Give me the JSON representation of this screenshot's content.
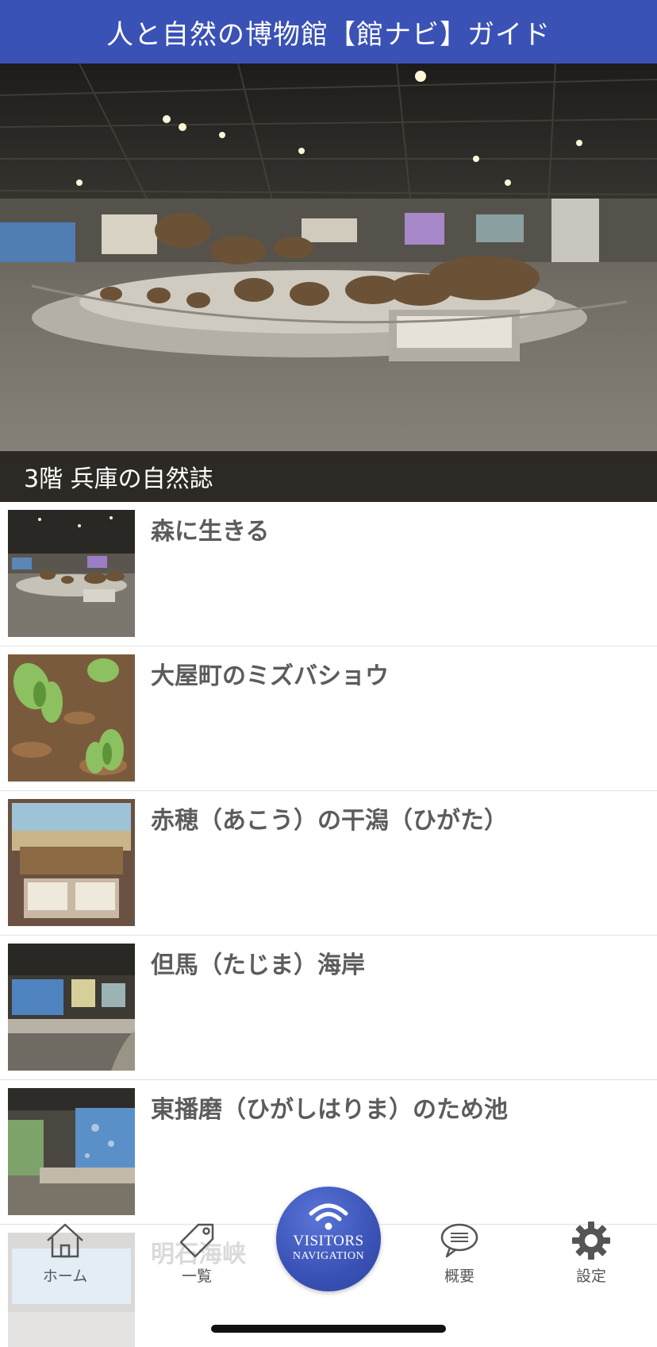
{
  "header": {
    "title": "人と自然の博物館【館ナビ】ガイド"
  },
  "hero": {
    "caption": "3階 兵庫の自然誌"
  },
  "list": [
    {
      "title": "森に生きる",
      "thumb": "forest-diorama-image"
    },
    {
      "title": "大屋町のミズバショウ",
      "thumb": "skunk-cabbage-image"
    },
    {
      "title": "赤穂（あこう）の干潟（ひがた）",
      "thumb": "tideflat-display-image"
    },
    {
      "title": "但馬（たじま）海岸",
      "thumb": "coast-display-image"
    },
    {
      "title": "東播磨（ひがしはりま）のため池",
      "thumb": "pond-display-image"
    },
    {
      "title": "明石海峡",
      "thumb": "strait-display-image"
    }
  ],
  "tabbar": {
    "home": {
      "label": "ホーム",
      "icon": "home-icon"
    },
    "list": {
      "label": "一覧",
      "icon": "tag-icon"
    },
    "center": {
      "line1": "VISITORS",
      "line2": "NAVIGATION",
      "icon": "wifi-icon"
    },
    "overview": {
      "label": "概要",
      "icon": "speech-bubble-icon"
    },
    "settings": {
      "label": "設定",
      "icon": "gear-icon"
    }
  },
  "colors": {
    "accent": "#3a52b5",
    "title_text": "#5c5c5c"
  }
}
